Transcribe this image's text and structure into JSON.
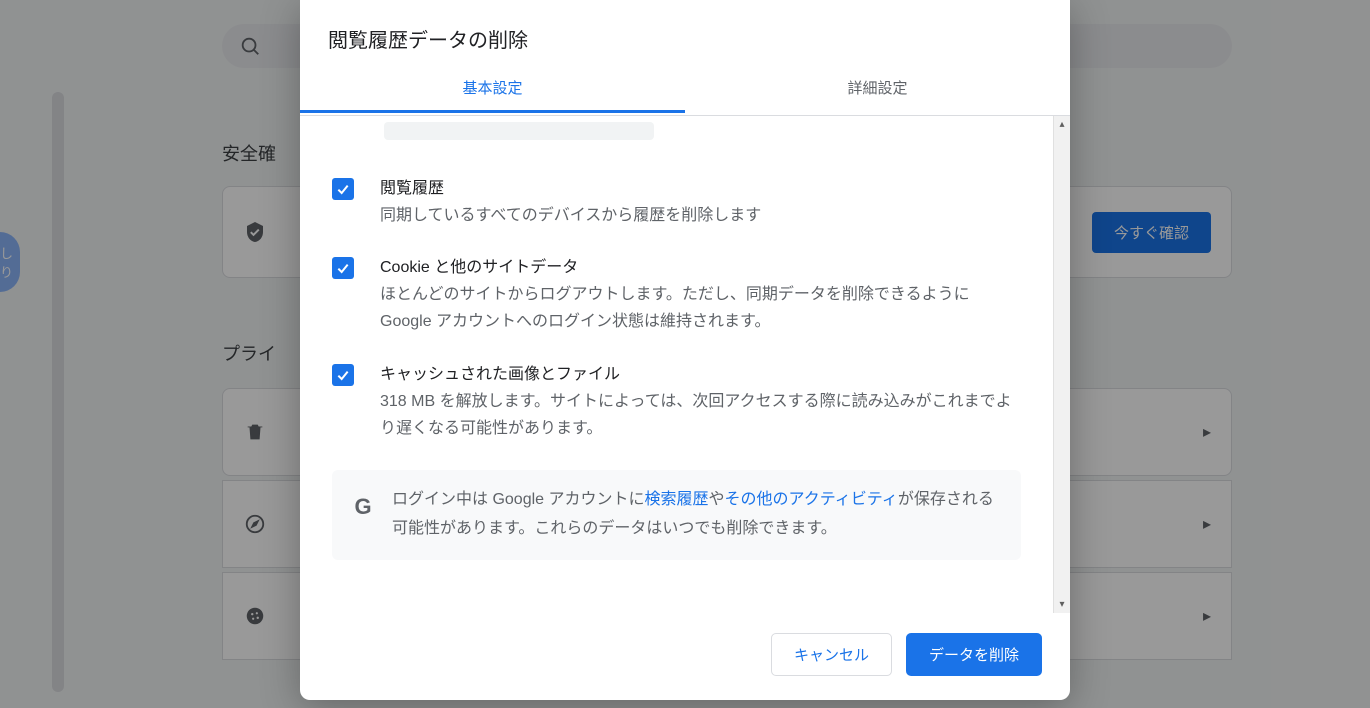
{
  "background": {
    "section1_title": "安全確",
    "section2_title": "プライ",
    "check_now_label": "今すぐ確認",
    "avatar_text": "しり"
  },
  "modal": {
    "title": "閲覧履歴データの削除",
    "tabs": {
      "basic": "基本設定",
      "advanced": "詳細設定"
    },
    "items": {
      "history": {
        "title": "閲覧履歴",
        "desc": "同期しているすべてのデバイスから履歴を削除します"
      },
      "cookies": {
        "title": "Cookie と他のサイトデータ",
        "desc": "ほとんどのサイトからログアウトします。ただし、同期データを削除できるように Google アカウントへのログイン状態は維持されます。"
      },
      "cache": {
        "title": "キャッシュされた画像とファイル",
        "desc": "318 MB を解放します。サイトによっては、次回アクセスする際に読み込みがこれまでより遅くなる可能性があります。"
      }
    },
    "info": {
      "pre": "ログイン中は Google アカウントに",
      "link1": "検索履歴",
      "mid1": "や",
      "link2": "その他のアクティビティ",
      "post": "が保存される可能性があります。これらのデータはいつでも削除できます。"
    },
    "footer": {
      "cancel": "キャンセル",
      "confirm": "データを削除"
    }
  }
}
